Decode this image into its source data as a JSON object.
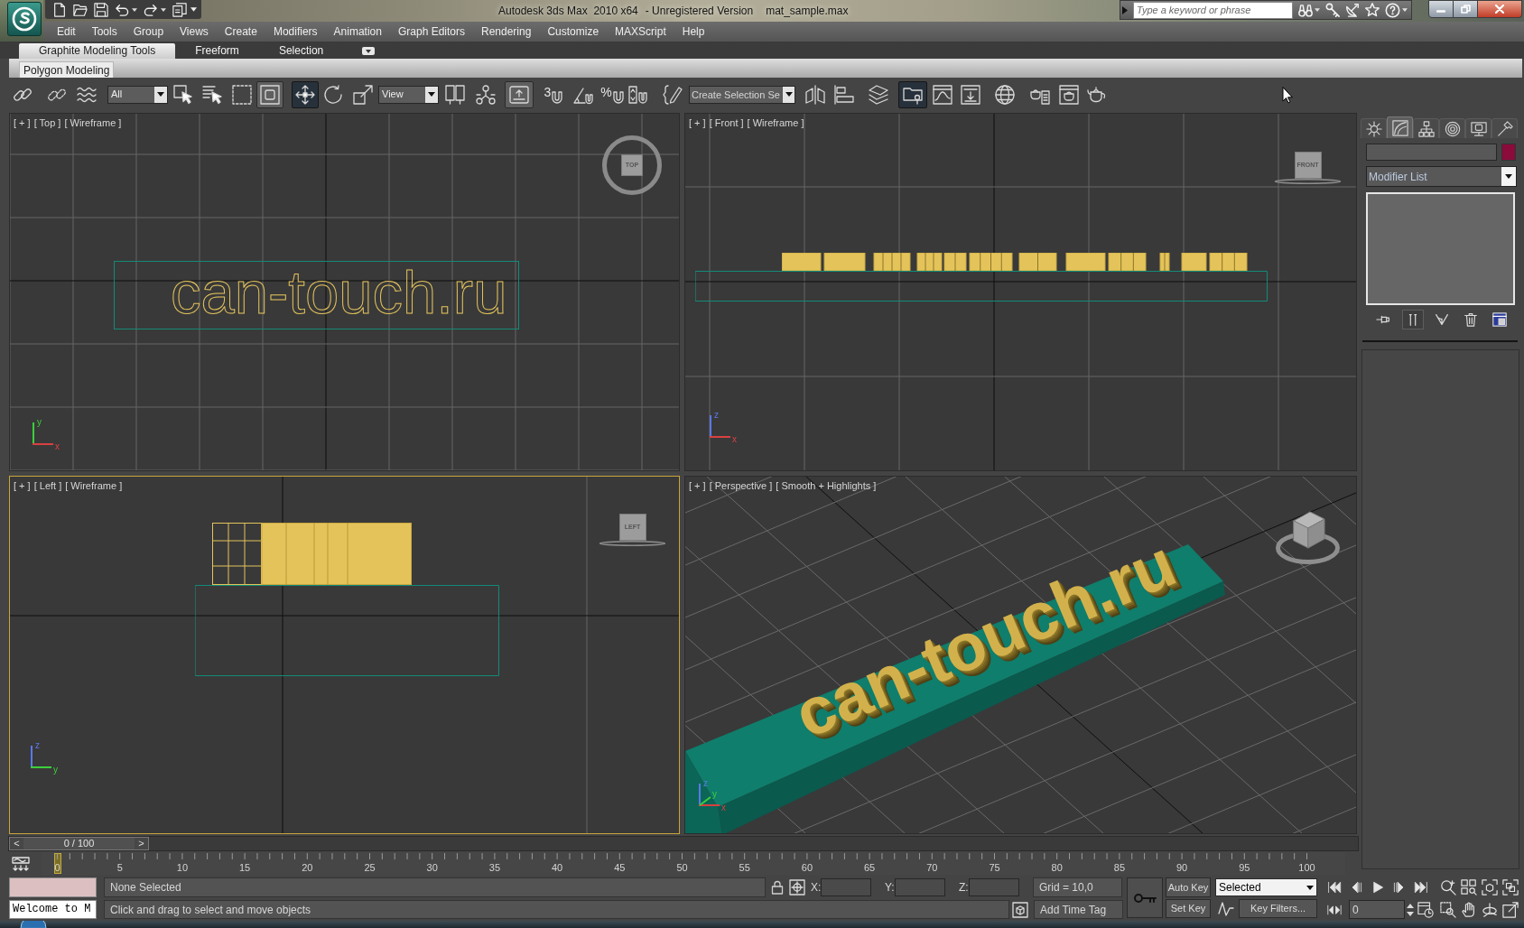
{
  "title_bar": {
    "app": "Autodesk 3ds Max  2010 x64",
    "edition": "- Unregistered Version",
    "file": "mat_sample.max",
    "search": {
      "placeholder": "Type a keyword or phrase"
    }
  },
  "menu_bar": [
    "Edit",
    "Tools",
    "Group",
    "Views",
    "Create",
    "Modifiers",
    "Animation",
    "Graph Editors",
    "Rendering",
    "Customize",
    "MAXScript",
    "Help"
  ],
  "ribbon": {
    "tabs": [
      {
        "label": "Graphite Modeling Tools",
        "selected": true
      },
      {
        "label": "Freeform",
        "selected": false
      },
      {
        "label": "Selection",
        "selected": false
      }
    ],
    "panel": "Polygon Modeling"
  },
  "main_toolbar": [
    {
      "kind": "link",
      "selected": false
    },
    {
      "kind": "unlink",
      "selected": false
    },
    {
      "kind": "bind",
      "selected": false
    },
    {
      "kind": "filter_dropdown",
      "value": "All"
    },
    {
      "kind": "select",
      "selected": false
    },
    {
      "kind": "select_by_name",
      "selected": false
    },
    {
      "kind": "region",
      "selected": false
    },
    {
      "kind": "crossing",
      "selected": true
    },
    {
      "kind": "move",
      "selected": true
    },
    {
      "kind": "rotate",
      "selected": false
    },
    {
      "kind": "scale",
      "selected": false
    },
    {
      "kind": "coordinate_dropdown",
      "value": "View"
    },
    {
      "kind": "pivot",
      "selected": false
    },
    {
      "kind": "manipulate",
      "selected": false
    },
    {
      "kind": "shortcut_override",
      "selected": true
    },
    {
      "kind": "snap",
      "label": "3",
      "selected": false
    },
    {
      "kind": "angle_snap",
      "selected": false
    },
    {
      "kind": "percent_snap",
      "label": "%",
      "selected": false
    },
    {
      "kind": "spinner_snap",
      "selected": false
    },
    {
      "kind": "named_selection",
      "selected": false
    },
    {
      "kind": "selection_set",
      "placeholder": "Create Selection Se"
    },
    {
      "kind": "mirror",
      "selected": false
    },
    {
      "kind": "align",
      "selected": false
    },
    {
      "kind": "layers",
      "selected": false
    },
    {
      "kind": "graphite",
      "selected": true
    },
    {
      "kind": "curve_editor",
      "selected": false
    },
    {
      "kind": "schematic",
      "selected": false
    },
    {
      "kind": "material_editor",
      "selected": false
    },
    {
      "kind": "render_setup",
      "selected": false
    },
    {
      "kind": "frame_window",
      "selected": false
    },
    {
      "kind": "render",
      "selected": false
    }
  ],
  "viewports": [
    {
      "kind": "top",
      "menu": "[ + ]",
      "view": "[ Top ]",
      "shading": "[ Wireframe ]",
      "active": false,
      "view_cube": "TOP",
      "object_text": "can-touch.ru",
      "axes": [
        {
          "label": "y",
          "color": "#3ccf3c"
        },
        {
          "label": "x",
          "color": "#d84040"
        }
      ]
    },
    {
      "kind": "front",
      "menu": "[ + ]",
      "view": "[ Front ]",
      "shading": "[ Wireframe ]",
      "active": false,
      "view_cube": "FRONT",
      "axes": [
        {
          "label": "z",
          "color": "#5a78e8"
        },
        {
          "label": "x",
          "color": "#d84040"
        }
      ]
    },
    {
      "kind": "left",
      "menu": "[ + ]",
      "view": "[ Left ]",
      "shading": "[ Wireframe ]",
      "active": true,
      "view_cube": "LEFT",
      "axes": [
        {
          "label": "z",
          "color": "#5a78e8"
        },
        {
          "label": "y",
          "color": "#3ccf3c"
        }
      ]
    },
    {
      "kind": "perspective",
      "menu": "[ + ]",
      "view": "[ Perspective ]",
      "shading": "[ Smooth + Highlights ]",
      "active": false,
      "object_text": "can-touch.ru",
      "axes": [
        {
          "label": "z",
          "color": "#5a78e8"
        },
        {
          "label": "x",
          "color": "#d84040"
        },
        {
          "label": "y",
          "color": "#3ccf3c"
        }
      ]
    }
  ],
  "command_panel": {
    "tabs": [
      {
        "kind": "create",
        "selected": false
      },
      {
        "kind": "modify",
        "selected": true
      },
      {
        "kind": "hierarchy",
        "selected": false
      },
      {
        "kind": "motion",
        "selected": false
      },
      {
        "kind": "display",
        "selected": false
      },
      {
        "kind": "utilities",
        "selected": false
      }
    ],
    "modifier_list": "Modifier List",
    "stack_tools": [
      {
        "kind": "pin",
        "selected": false
      },
      {
        "kind": "end_result",
        "selected": true
      },
      {
        "kind": "make_unique",
        "selected": false
      },
      {
        "kind": "remove",
        "selected": false
      },
      {
        "kind": "configure",
        "selected": false
      }
    ]
  },
  "time_slider": {
    "back": "<",
    "reading": "0 / 100",
    "forward": ">",
    "level": 0
  },
  "track_bar": {
    "labels": [
      "0",
      "5",
      "10",
      "15",
      "20",
      "25",
      "30",
      "35",
      "40",
      "45",
      "50",
      "55",
      "60",
      "65",
      "70",
      "75",
      "80",
      "85",
      "90",
      "95",
      "100"
    ],
    "level": 0
  },
  "status_bar": {
    "listener_output": "Welcome to M",
    "selection": "None Selected",
    "prompt": "Click and drag to select and move objects",
    "axes": [
      "X:",
      "Y:",
      "Z:"
    ],
    "grid": "Grid = 10,0",
    "time_tag": "Add Time Tag",
    "auto_key": {
      "label": "Auto Key",
      "on": false
    },
    "key_filter_mode": "Selected",
    "set_key": "Set Key",
    "key_filters": "Key Filters...",
    "frame": "0"
  }
}
